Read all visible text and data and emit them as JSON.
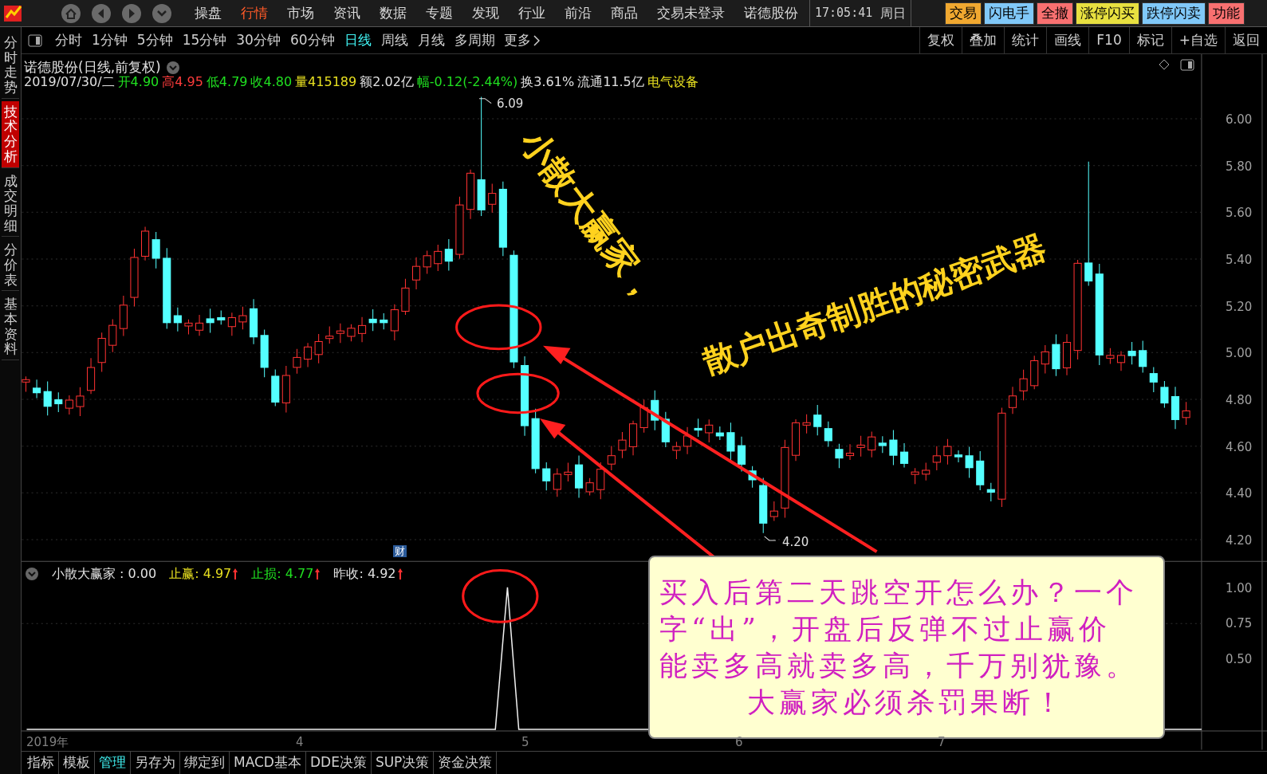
{
  "menu_bar": {
    "items": [
      {
        "label": "操盘",
        "selected": false
      },
      {
        "label": "行情",
        "selected": true
      },
      {
        "label": "市场",
        "selected": false
      },
      {
        "label": "资讯",
        "selected": false
      },
      {
        "label": "数据",
        "selected": false
      },
      {
        "label": "专题",
        "selected": false
      },
      {
        "label": "发现",
        "selected": false
      },
      {
        "label": "行业",
        "selected": false
      },
      {
        "label": "前沿",
        "selected": false
      },
      {
        "label": "商品",
        "selected": false
      },
      {
        "label": "交易未登录",
        "selected": false
      },
      {
        "label": "诺德股份",
        "selected": false
      }
    ],
    "time": "17:05:41",
    "weekday": "周日",
    "quick_buttons": [
      {
        "label": "交易",
        "color": "#f0a830"
      },
      {
        "label": "闪电手",
        "color": "#80c8f8"
      },
      {
        "label": "全撤",
        "color": "#f87070"
      },
      {
        "label": "涨停闪买",
        "color": "#e8e040"
      },
      {
        "label": "跌停闪卖",
        "color": "#80c8f8"
      },
      {
        "label": "功能",
        "color": "#f87070"
      }
    ]
  },
  "side_tabs": [
    {
      "label": "分时走势",
      "selected": false
    },
    {
      "label": "技术分析",
      "selected": true
    },
    {
      "label": "成交明细",
      "selected": false
    },
    {
      "label": "分价表",
      "selected": false
    },
    {
      "label": "基本资料",
      "selected": false
    }
  ],
  "period_bar": {
    "items": [
      {
        "label": "分时",
        "selected": false
      },
      {
        "label": "1分钟",
        "selected": false
      },
      {
        "label": "5分钟",
        "selected": false
      },
      {
        "label": "15分钟",
        "selected": false
      },
      {
        "label": "30分钟",
        "selected": false
      },
      {
        "label": "60分钟",
        "selected": false
      },
      {
        "label": "日线",
        "selected": true
      },
      {
        "label": "周线",
        "selected": false
      },
      {
        "label": "月线",
        "selected": false
      },
      {
        "label": "多周期",
        "selected": false
      }
    ],
    "more": "更多",
    "tools": [
      "复权",
      "叠加",
      "统计",
      "画线",
      "F10",
      "标记",
      "+自选",
      "返回"
    ]
  },
  "chart": {
    "title": "诺德股份(日线,前复权)",
    "quote": [
      {
        "text": "2019/07/30/二",
        "color": "#e0e0e0"
      },
      {
        "text": "开4.90",
        "color": "#20e020"
      },
      {
        "text": "高4.95",
        "color": "#ff3c3c"
      },
      {
        "text": "低4.79",
        "color": "#20e020"
      },
      {
        "text": "收4.80",
        "color": "#20e020"
      },
      {
        "text": "量415189",
        "color": "#e8e020"
      },
      {
        "text": "额2.02亿",
        "color": "#e0e0e0"
      },
      {
        "text": "幅-0.12(-2.44%)",
        "color": "#20e020"
      },
      {
        "text": "换3.61%",
        "color": "#e0e0e0"
      },
      {
        "text": "流通11.5亿",
        "color": "#e0e0e0"
      },
      {
        "text": "电气设备",
        "color": "#e8e020"
      }
    ],
    "high_label": "6.09",
    "low_label": "4.20",
    "event_badge": "财",
    "price_axis": [
      "6.00",
      "5.80",
      "5.60",
      "5.40",
      "5.20",
      "5.00",
      "4.80",
      "4.60",
      "4.40",
      "4.20"
    ],
    "slogan_1": "小散大赢家，",
    "slogan_2": "散户出奇制胜的秘密武器"
  },
  "indicator": {
    "header": [
      {
        "text": "小散大赢家 : 0.00",
        "color": "#e0e0e0",
        "arrow": false
      },
      {
        "text": "止赢: 4.97",
        "color": "#e8e020",
        "arrow": true
      },
      {
        "text": "止损: 4.77",
        "color": "#20e020",
        "arrow": true
      },
      {
        "text": "昨收: 4.92",
        "color": "#e0e0e0",
        "arrow": true
      }
    ],
    "axis": [
      "1.00",
      "0.75",
      "0.50"
    ]
  },
  "date_axis": [
    "2019年",
    "4",
    "5",
    "6",
    "7"
  ],
  "callout": {
    "lines": [
      "买入后第二天跳空开怎么办？一个",
      "字“出”，开盘后反弹不过止赢价",
      "能卖多高就卖多高，千万别犹豫。",
      "大赢家必须杀罚果断！"
    ]
  },
  "bottom_tabs": [
    {
      "label": "指标",
      "selected": false
    },
    {
      "label": "模板",
      "selected": false
    },
    {
      "label": "管理",
      "selected": true
    },
    {
      "label": "另存为",
      "selected": false
    },
    {
      "label": "绑定到",
      "selected": false
    },
    {
      "label": "MACD基本",
      "selected": false
    },
    {
      "label": "DDE决策",
      "selected": false
    },
    {
      "label": "SUP决策",
      "selected": false
    },
    {
      "label": "资金决策",
      "selected": false
    }
  ]
}
